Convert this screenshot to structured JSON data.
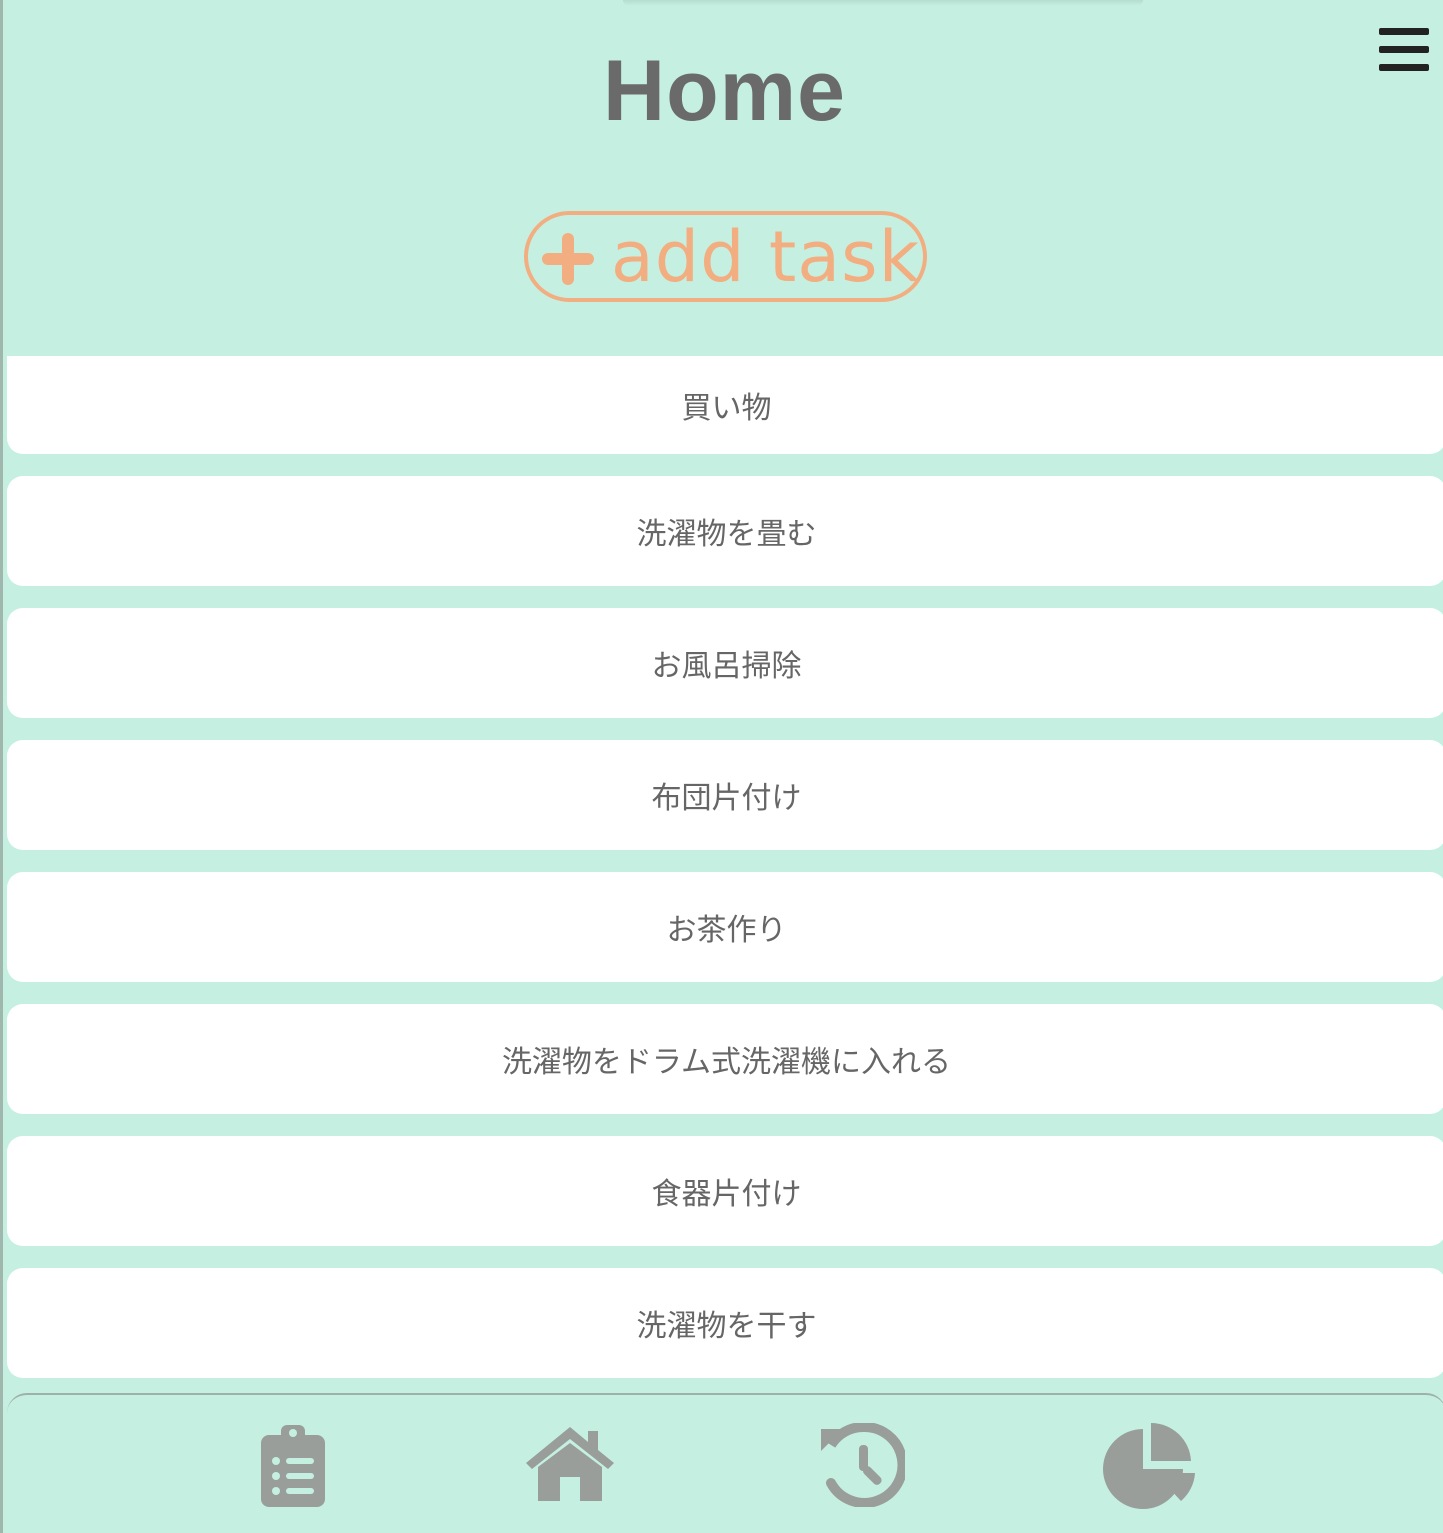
{
  "header": {
    "title": "Home",
    "menu_icon": "hamburger-menu-icon"
  },
  "add_task": {
    "label": "add task",
    "icon": "plus-icon",
    "color": "#f2ae80"
  },
  "tasks": [
    {
      "label": "買い物"
    },
    {
      "label": "洗濯物を畳む"
    },
    {
      "label": "お風呂掃除"
    },
    {
      "label": "布団片付け"
    },
    {
      "label": "お茶作り"
    },
    {
      "label": "洗濯物をドラム式洗濯機に入れる"
    },
    {
      "label": "食器片付け"
    },
    {
      "label": "洗濯物を干す"
    }
  ],
  "bottom_nav": {
    "items": [
      {
        "icon": "clipboard-list-icon"
      },
      {
        "icon": "home-icon"
      },
      {
        "icon": "history-icon"
      },
      {
        "icon": "pie-chart-icon"
      }
    ],
    "icon_color": "#999e9b"
  },
  "colors": {
    "background": "#c5f0e1",
    "card": "#ffffff",
    "text": "#666666"
  }
}
